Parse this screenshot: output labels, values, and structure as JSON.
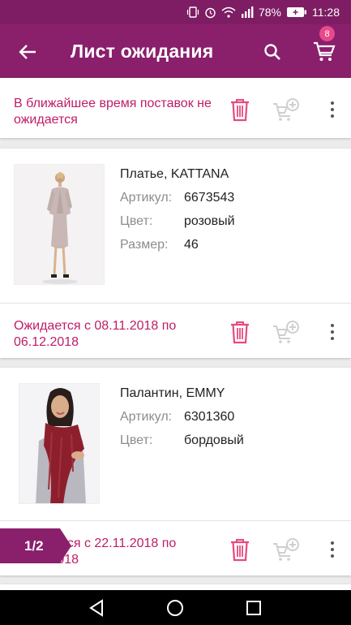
{
  "status_bar": {
    "battery": "78%",
    "time": "11:28",
    "icons": [
      "vibrate-icon",
      "alarm-icon",
      "wifi-icon",
      "signal-icon",
      "battery-icon"
    ]
  },
  "app_bar": {
    "title": "Лист ожидания",
    "cart_count": "8",
    "icons": [
      "back-arrow-icon",
      "search-icon",
      "cart-icon"
    ]
  },
  "items": [
    {
      "status": "В ближайшее время поставок не ожидается"
    },
    {
      "name": "Платье, KATTANA",
      "attributes": [
        {
          "label": "Артикул:",
          "value": "6673543"
        },
        {
          "label": "Цвет:",
          "value": "розовый"
        },
        {
          "label": "Размер:",
          "value": "46"
        }
      ],
      "status": "Ожидается с 08.11.2018 по 06.12.2018"
    },
    {
      "name": "Палантин, EMMY",
      "attributes": [
        {
          "label": "Артикул:",
          "value": "6301360"
        },
        {
          "label": "Цвет:",
          "value": "бордовый"
        }
      ],
      "status": "Ожидается с 22.11.2018 по 06.12.2018"
    }
  ],
  "page_indicator": "1/2",
  "colors": {
    "primary": "#8a1f6c",
    "status_bar": "#7e1d63",
    "accent_text": "#bf1c67",
    "trash_icon": "#e8497f",
    "disabled_icon": "#cfcfcf",
    "badge": "#e8498a"
  }
}
